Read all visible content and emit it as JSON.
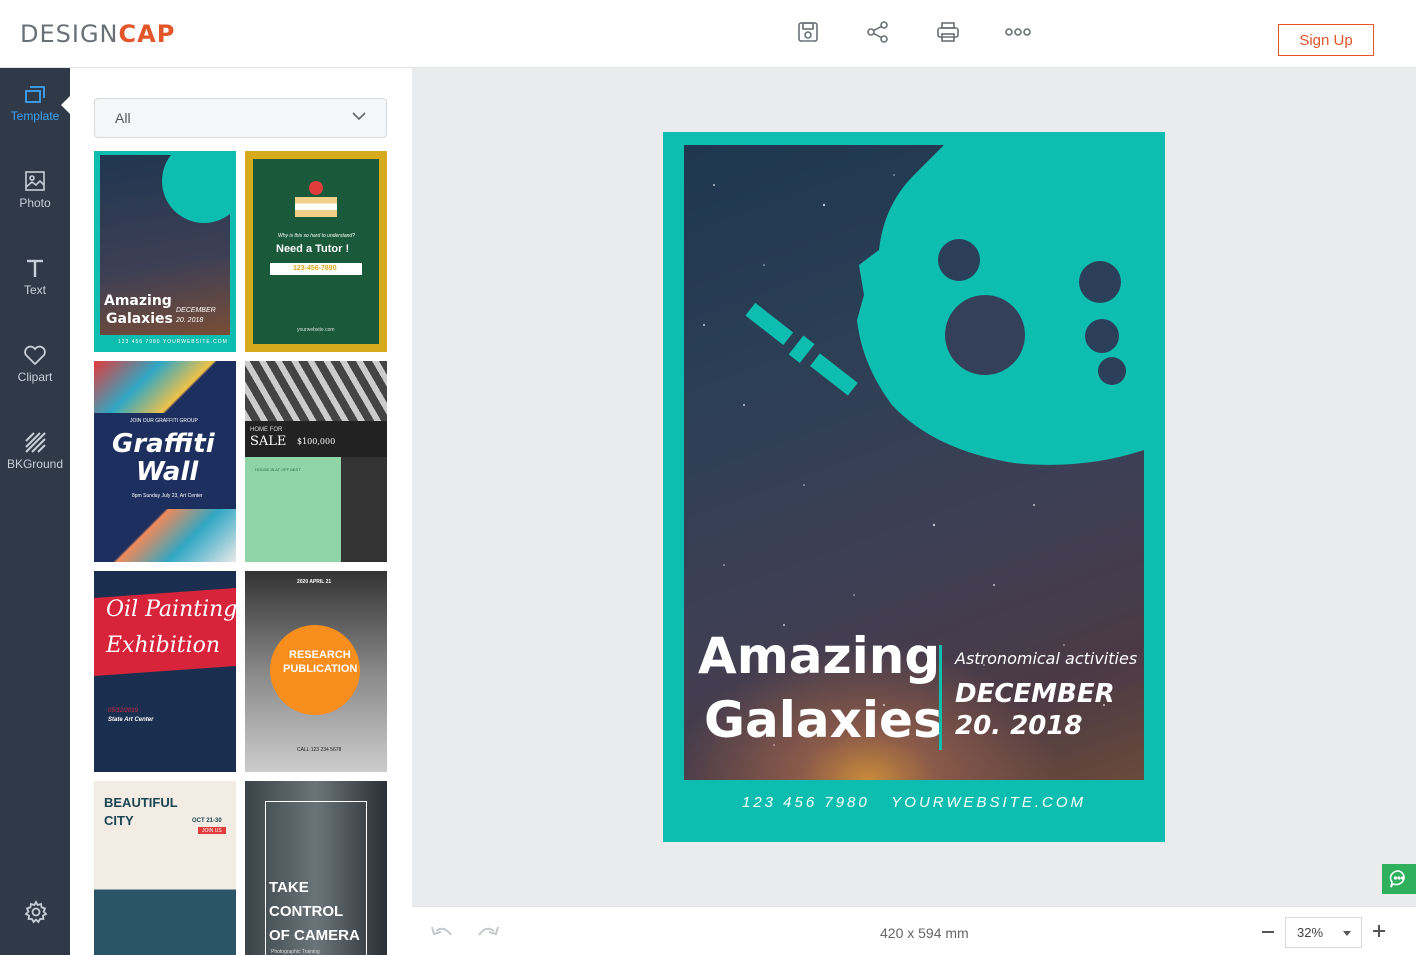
{
  "brand": {
    "logo_prefix": "DESIGN",
    "logo_accent": "CAP"
  },
  "header": {
    "signup_label": "Sign Up"
  },
  "sidebar": {
    "items": [
      {
        "label": "Template"
      },
      {
        "label": "Photo"
      },
      {
        "label": "Text"
      },
      {
        "label": "Clipart"
      },
      {
        "label": "BKGround"
      }
    ]
  },
  "panel": {
    "filter_value": "All",
    "templates": [
      {
        "line1": "Amazing",
        "line2": "Galaxies",
        "detail": "DECEMBER",
        "detail2": "20. 2018",
        "footer": "123 456 7980   YOURWEBSITE.COM"
      },
      {
        "line1": "Why is this so hard to understand?",
        "line2": "Need a Tutor !",
        "detail": "123-456-7890",
        "footer": "yourwebsite.com"
      },
      {
        "line1": "JOIN OUR GRAFFITI GROUP",
        "line2": "Graffiti",
        "detail": "Wall",
        "footer": "8pm Sunday July 23, Art Center"
      },
      {
        "line1": "HOME FOR",
        "line2": "SALE",
        "detail": "$100,000",
        "footer": "HOUSE IN AT OFF BEST"
      },
      {
        "line1": "Oil Painting",
        "line2": "Exhibition",
        "detail": "05/12/2019",
        "footer": "State Art Center"
      },
      {
        "line1": "2020 APRIL 21",
        "line2": "RESEARCH",
        "detail": "PUBLICATION",
        "footer": "CALL 123 234 5678"
      },
      {
        "line1": "BEAUTIFUL",
        "line2": "CITY",
        "detail": "OCT 21-30",
        "footer": "JOIN US"
      },
      {
        "line1": "TAKE",
        "line2": "CONTROL",
        "detail": "OF CAMERA",
        "footer": "Photographic Training"
      }
    ]
  },
  "canvas": {
    "title_line1": "Amazing",
    "title_line2": "Galaxies",
    "subtitle": "Astronomical activities",
    "date_line1": "DECEMBER",
    "date_line2": "20. 2018",
    "contact_phone": "123 456 7980",
    "contact_web": "YOURWEBSITE.COM"
  },
  "bottom": {
    "dimensions": "420 x 594 mm",
    "zoom": "32%"
  },
  "colors": {
    "accent": "#e2562a",
    "teal": "#0dbdb0",
    "sidebar": "#2f3947",
    "active": "#3da3f5"
  }
}
